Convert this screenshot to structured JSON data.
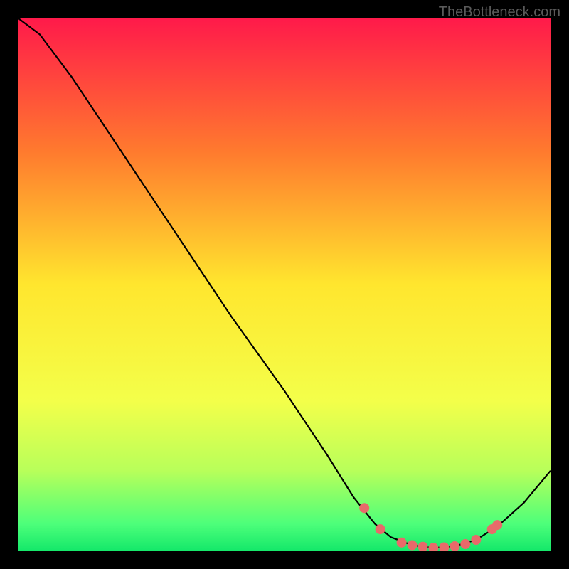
{
  "watermark_text": "TheBottleneck.com",
  "chart_data": {
    "type": "line",
    "title": "",
    "xlabel": "",
    "ylabel": "",
    "xlim": [
      0,
      100
    ],
    "ylim": [
      0,
      100
    ],
    "grid": false,
    "background": "gradient red-yellow-green (unlabeled heatmap)",
    "curve": [
      {
        "x": 0,
        "y": 100
      },
      {
        "x": 4,
        "y": 97
      },
      {
        "x": 10,
        "y": 89
      },
      {
        "x": 20,
        "y": 74
      },
      {
        "x": 30,
        "y": 59
      },
      {
        "x": 40,
        "y": 44
      },
      {
        "x": 50,
        "y": 30
      },
      {
        "x": 58,
        "y": 18
      },
      {
        "x": 63,
        "y": 10
      },
      {
        "x": 67,
        "y": 5
      },
      {
        "x": 70,
        "y": 2.5
      },
      {
        "x": 74,
        "y": 1
      },
      {
        "x": 78,
        "y": 0.5
      },
      {
        "x": 82,
        "y": 0.8
      },
      {
        "x": 86,
        "y": 2
      },
      {
        "x": 90,
        "y": 4.5
      },
      {
        "x": 95,
        "y": 9
      },
      {
        "x": 100,
        "y": 15
      }
    ],
    "markers": [
      {
        "x": 65,
        "y": 8
      },
      {
        "x": 68,
        "y": 4
      },
      {
        "x": 72,
        "y": 1.5
      },
      {
        "x": 74,
        "y": 1
      },
      {
        "x": 76,
        "y": 0.7
      },
      {
        "x": 78,
        "y": 0.5
      },
      {
        "x": 80,
        "y": 0.6
      },
      {
        "x": 82,
        "y": 0.8
      },
      {
        "x": 84,
        "y": 1.2
      },
      {
        "x": 86,
        "y": 2
      },
      {
        "x": 89,
        "y": 4
      },
      {
        "x": 90,
        "y": 4.8
      }
    ],
    "gradient_stops": [
      {
        "offset": 0,
        "color": "#ff1a4a"
      },
      {
        "offset": 0.25,
        "color": "#ff7a2e"
      },
      {
        "offset": 0.5,
        "color": "#ffe62e"
      },
      {
        "offset": 0.72,
        "color": "#f3ff4a"
      },
      {
        "offset": 0.85,
        "color": "#b8ff5a"
      },
      {
        "offset": 0.95,
        "color": "#4dff7a"
      },
      {
        "offset": 1.0,
        "color": "#15e86a"
      }
    ],
    "marker_color": "#e86a6a",
    "curve_color": "#000000"
  }
}
